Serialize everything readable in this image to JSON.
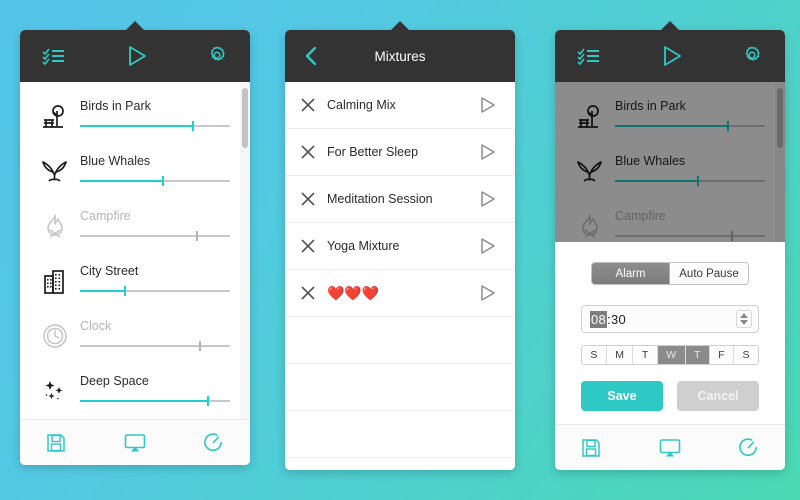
{
  "theme": {
    "accent": "#21cfd0",
    "header_bg": "#333333",
    "bg_from": "#53c5e8",
    "bg_to": "#4ad9b4",
    "save_green": "#2ec9c4",
    "cancel_grey": "#cfcfcf"
  },
  "sounds_panel": {
    "header": {
      "list_icon": "checklist-icon",
      "play_icon": "play-icon",
      "settings_icon": "gear-icon"
    },
    "items": [
      {
        "label": "Birds in Park",
        "icon": "tree-bench-icon",
        "volume": 75,
        "enabled": true
      },
      {
        "label": "Blue Whales",
        "icon": "whale-tail-icon",
        "volume": 55,
        "enabled": true
      },
      {
        "label": "Campfire",
        "icon": "flame-icon",
        "volume": 78,
        "enabled": false
      },
      {
        "label": "City Street",
        "icon": "buildings-icon",
        "volume": 30,
        "enabled": true
      },
      {
        "label": "Clock",
        "icon": "clock-icon",
        "volume": 80,
        "enabled": false
      },
      {
        "label": "Deep Space",
        "icon": "sparkles-icon",
        "volume": 85,
        "enabled": true
      }
    ],
    "toolbar": {
      "save_icon": "floppy-disk-icon",
      "cast_icon": "airplay-icon",
      "timer_icon": "timer-icon"
    }
  },
  "mixtures_panel": {
    "header": {
      "back_icon": "chevron-left-icon",
      "title": "Mixtures"
    },
    "rows": [
      {
        "name": "Calming Mix",
        "remove_icon": "close-icon",
        "play_icon": "play-icon"
      },
      {
        "name": "For Better Sleep",
        "remove_icon": "close-icon",
        "play_icon": "play-icon"
      },
      {
        "name": "Meditation Session",
        "remove_icon": "close-icon",
        "play_icon": "play-icon"
      },
      {
        "name": "Yoga Mixture",
        "remove_icon": "close-icon",
        "play_icon": "play-icon"
      },
      {
        "name": "❤️❤️❤️",
        "remove_icon": "close-icon",
        "play_icon": "play-icon"
      }
    ],
    "empty_rows": 3
  },
  "alarm_panel": {
    "header": {
      "list_icon": "checklist-icon",
      "play_icon": "play-icon",
      "settings_icon": "gear-icon"
    },
    "background_items": [
      {
        "label": "Birds in Park",
        "icon": "tree-bench-icon",
        "volume": 75,
        "enabled": true
      },
      {
        "label": "Blue Whales",
        "icon": "whale-tail-icon",
        "volume": 55,
        "enabled": true
      },
      {
        "label": "Campfire",
        "icon": "flame-icon",
        "volume": 78,
        "enabled": false
      }
    ],
    "modal": {
      "tabs": [
        {
          "label": "Alarm",
          "active": true
        },
        {
          "label": "Auto Pause",
          "active": false
        }
      ],
      "time": {
        "hours": "08",
        "separator": ":",
        "minutes": "30"
      },
      "spinner_icon": "stepper-up-down-icon",
      "days": [
        {
          "label": "S",
          "selected": false
        },
        {
          "label": "M",
          "selected": false
        },
        {
          "label": "T",
          "selected": false
        },
        {
          "label": "W",
          "selected": true
        },
        {
          "label": "T",
          "selected": true
        },
        {
          "label": "F",
          "selected": false
        },
        {
          "label": "S",
          "selected": false
        }
      ],
      "save_label": "Save",
      "cancel_label": "Cancel"
    },
    "toolbar": {
      "save_icon": "floppy-disk-icon",
      "cast_icon": "airplay-icon",
      "timer_icon": "timer-icon"
    }
  }
}
